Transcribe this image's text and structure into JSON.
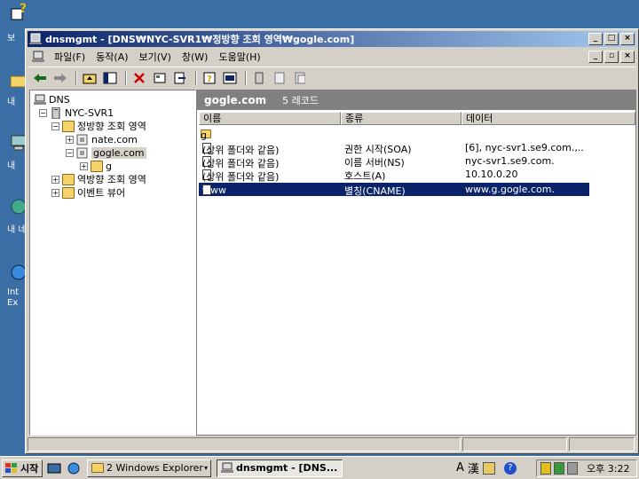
{
  "window": {
    "title": "dnsmgmt - [DNS₩NYC-SVR1₩정방향 조회 영역₩gogle.com]",
    "caption_buttons": [
      "_",
      "□",
      "×"
    ],
    "mdi_buttons": [
      "_",
      "▫",
      "×"
    ]
  },
  "menu": [
    "파일(F)",
    "동작(A)",
    "보기(V)",
    "창(W)",
    "도움말(H)"
  ],
  "toolbar_icons": [
    "back-icon",
    "forward-icon",
    "up-folder-icon",
    "show-tree-icon",
    "delete-icon",
    "properties-icon",
    "export-icon",
    "help-icon",
    "console-icon",
    "server-icon",
    "zone-icon",
    "record-icon"
  ],
  "tree": {
    "root": "DNS",
    "server": "NYC-SVR1",
    "forward_zone": "정방향 조회 영역",
    "zones": [
      "nate.com",
      "gogle.com"
    ],
    "subdomain": "g",
    "reverse_zone": "역방향 조회 영역",
    "event_viewer": "이벤트 뷰어"
  },
  "details": {
    "zone_name": "gogle.com",
    "record_count": "5 레코드",
    "columns": [
      "이름",
      "종류",
      "데이터"
    ],
    "records": [
      {
        "name": "g",
        "type": "",
        "data": "",
        "icon": "folder-icon"
      },
      {
        "name": "(상위 폴더와 같음)",
        "type": "권한 시작(SOA)",
        "data": "[6], nyc-svr1.se9.com.,..",
        "icon": "record-icon"
      },
      {
        "name": "(상위 폴더와 같음)",
        "type": "이름 서버(NS)",
        "data": "nyc-svr1.se9.com.",
        "icon": "record-icon"
      },
      {
        "name": "(상위 폴더와 같음)",
        "type": "호스트(A)",
        "data": "10.10.0.20",
        "icon": "record-icon"
      },
      {
        "name": "www",
        "type": "별칭(CNAME)",
        "data": "www.g.gogle.com.",
        "icon": "record-icon"
      }
    ]
  },
  "taskbar": {
    "start": "시작",
    "tasks": [
      "2 Windows Explorer",
      "dnsmgmt - [DNS..."
    ],
    "tray_ime": [
      "A",
      "漢"
    ],
    "clock": "오후 3:22"
  },
  "desktop_labels": [
    "보",
    "내",
    "내",
    "내 네",
    "Int",
    "Ex"
  ],
  "colors": {
    "desktop": "#3a6ea5",
    "title_start": "#0a246a",
    "title_end": "#a6caf0",
    "selection": "#0a246a"
  }
}
